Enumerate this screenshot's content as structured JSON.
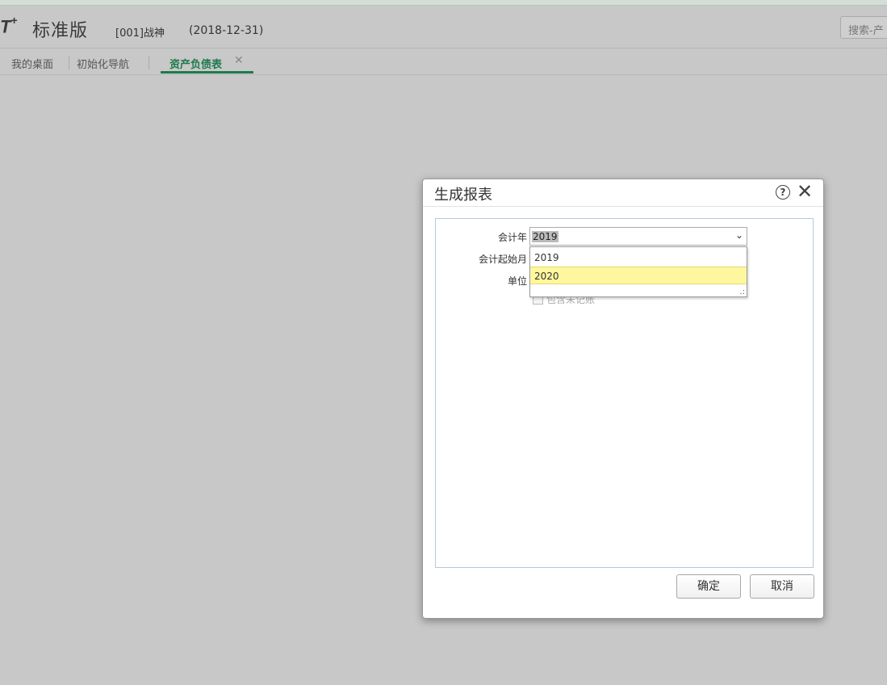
{
  "header": {
    "logo": "T",
    "logo_sup": "+",
    "edition": "标准版",
    "company": "[001]战神",
    "date": "(2018-12-31)",
    "search_placeholder": "搜索-产"
  },
  "tabs": [
    {
      "label": "我的桌面"
    },
    {
      "label": "初始化导航"
    },
    {
      "label": "资产负债表",
      "active": true
    }
  ],
  "dialog": {
    "title": "生成报表",
    "fields": {
      "year_label": "会计年",
      "year_value": "2019",
      "start_month_label": "会计起始月",
      "unit_label": "单位",
      "checkbox_label": "包含未记账"
    },
    "year_options": [
      "2019",
      "2020"
    ],
    "selected_option": "2020",
    "buttons": {
      "ok": "确定",
      "cancel": "取消"
    }
  },
  "colors": {
    "accent": "#1e7a4e",
    "highlight": "#fff79e",
    "background": "#c8c8c8"
  }
}
